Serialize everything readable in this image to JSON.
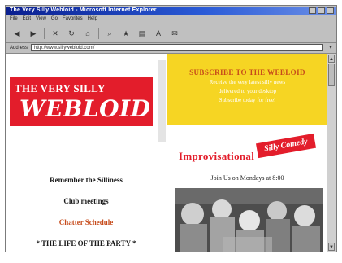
{
  "window": {
    "title": "The Very Silly Webloid - Microsoft Internet Explorer"
  },
  "menubar": {
    "items": [
      "File",
      "Edit",
      "View",
      "Go",
      "Favorites",
      "Help"
    ]
  },
  "toolbar": {
    "buttons": [
      "back",
      "forward",
      "stop",
      "refresh",
      "home",
      "search",
      "favorites",
      "print",
      "font",
      "mail"
    ]
  },
  "address": {
    "label": "Address",
    "value": "http://www.sillywebloid.com/",
    "go": "▾"
  },
  "page": {
    "logo_small": "THE VERY SILLY",
    "logo_big": "WEBLOID",
    "banner_line1": "SUBSCRIBE TO THE WEBLOID",
    "banner_line2": "Receive the very latest silly news",
    "banner_line3": "delivered to your desktop",
    "banner_line4": "Subscribe today for free!",
    "pitch_main": "Improvisational",
    "pitch_stamp": "Silly Comedy",
    "pitch_sub": "Join Us on Mondays at 8:00",
    "nav": [
      "Remember the Silliness",
      "Club meetings",
      "Chatter Schedule",
      "* THE LIFE OF THE PARTY *"
    ]
  }
}
